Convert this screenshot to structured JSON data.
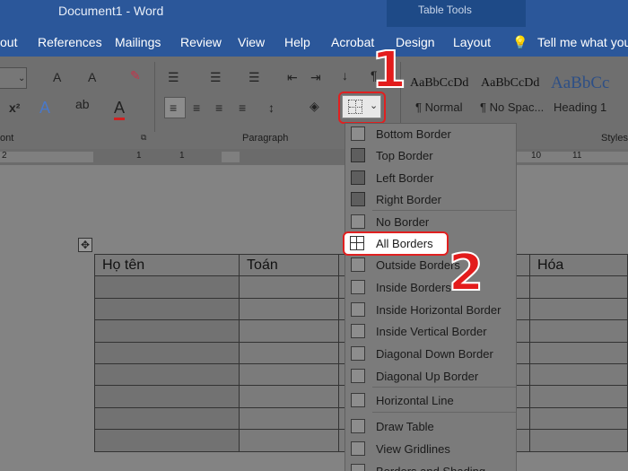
{
  "titlebar": {
    "title": "Document1  -  Word",
    "table_tools": "Table Tools"
  },
  "tabs": [
    "out",
    "References",
    "Mailings",
    "Review",
    "View",
    "Help",
    "Acrobat",
    "Design",
    "Layout"
  ],
  "tell_me": "Tell me what you",
  "ribbon": {
    "font_group": "ont",
    "paragraph_group": "Paragraph",
    "styles_group": "Styles",
    "styles": [
      {
        "sample": "AaBbCcDd",
        "name": "¶ Normal"
      },
      {
        "sample": "AaBbCcDd",
        "name": "¶ No Spac..."
      },
      {
        "sample": "AaBbCc",
        "name": "Heading 1"
      },
      {
        "sample": "Aa",
        "name": ""
      }
    ]
  },
  "ruler_ticks": [
    "2",
    "1",
    "1",
    "2",
    "10",
    "11"
  ],
  "annotations": {
    "step1": "1",
    "step2": "2"
  },
  "menu": {
    "items": [
      {
        "label": "Bottom Border",
        "active": false
      },
      {
        "label": "Top Border",
        "active": true
      },
      {
        "label": "Left Border",
        "active": true
      },
      {
        "label": "Right Border",
        "active": true
      },
      {
        "label": "No Border",
        "active": false
      },
      {
        "label": "All Borders",
        "active": false
      },
      {
        "label": "Outside Borders",
        "active": false
      },
      {
        "label": "Inside Borders",
        "active": false
      },
      {
        "label": "Inside Horizontal Border",
        "active": false
      },
      {
        "label": "Inside Vertical Border",
        "active": false
      },
      {
        "label": "Diagonal Down Border",
        "active": false
      },
      {
        "label": "Diagonal Up Border",
        "active": false
      },
      {
        "label": "Horizontal Line",
        "active": false
      },
      {
        "label": "Draw Table",
        "active": false
      },
      {
        "label": "View Gridlines",
        "active": false
      },
      {
        "label": "Borders and Shading...",
        "active": false
      }
    ]
  },
  "table": {
    "headers": [
      "Họ tên",
      "Toán",
      "",
      "Hóa"
    ],
    "row_count": 9
  }
}
